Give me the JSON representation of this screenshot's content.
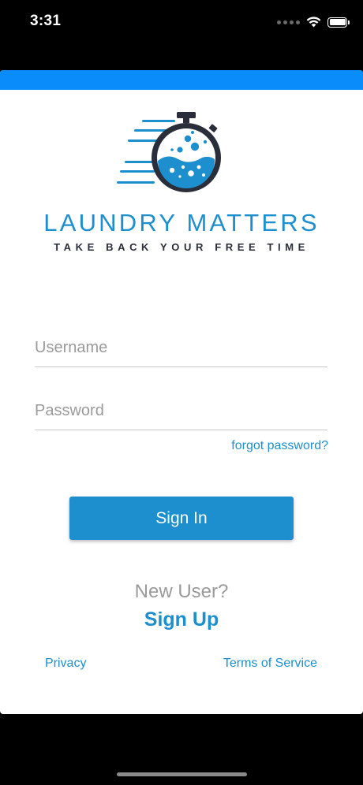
{
  "status_bar": {
    "time": "3:31",
    "icons": [
      "signal-icon",
      "wifi-icon",
      "battery-icon"
    ]
  },
  "colors": {
    "accent": "#1d8fce",
    "header_bar": "#0a8dfb",
    "logo_dark": "#2a2d3a",
    "muted_text": "#9a9a9a"
  },
  "logo": {
    "name": "LAUNDRY MATTERS",
    "tagline": "TAKE BACK YOUR FREE TIME",
    "icon": "stopwatch-icon"
  },
  "form": {
    "username": {
      "placeholder": "Username",
      "value": ""
    },
    "password": {
      "placeholder": "Password",
      "value": ""
    },
    "forgot_label": "forgot password?",
    "signin_label": "Sign In"
  },
  "signup": {
    "prompt": "New User?",
    "link_label": "Sign Up"
  },
  "footer": {
    "privacy_label": "Privacy",
    "terms_label": "Terms of Service"
  }
}
